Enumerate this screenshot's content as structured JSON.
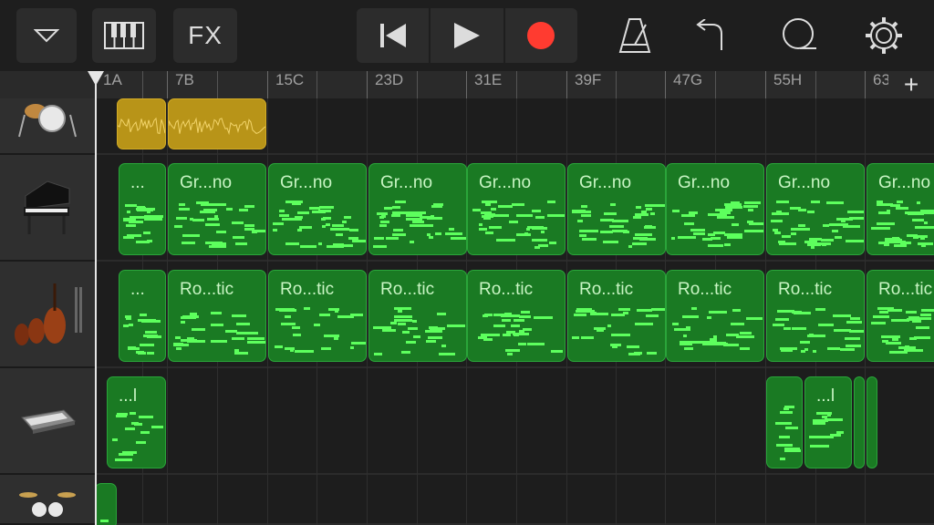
{
  "toolbar": {
    "dropdown_icon": "chevron-down-icon",
    "keyboard_icon": "piano-keyboard-icon",
    "fx_label": "FX",
    "rewind_icon": "skip-back-icon",
    "play_icon": "play-icon",
    "record_icon": "record-icon",
    "metronome_icon": "metronome-icon",
    "undo_icon": "undo-icon",
    "loop_icon": "loop-browser-icon",
    "settings_icon": "settings-gear-icon",
    "record_color": "#ff3b30"
  },
  "ruler": {
    "markers": [
      "1A",
      "7B",
      "15C",
      "23D",
      "31E",
      "39F",
      "47G",
      "55H",
      "63"
    ],
    "add_label": "+"
  },
  "tracks": [
    {
      "name": "drums",
      "icon": "drum-kit-icon"
    },
    {
      "name": "piano",
      "icon": "grand-piano-icon"
    },
    {
      "name": "strings",
      "icon": "string-ensemble-icon"
    },
    {
      "name": "keyboard",
      "icon": "synth-keyboard-icon"
    },
    {
      "name": "drums-2",
      "icon": "drum-kit-icon"
    }
  ],
  "regions": {
    "piano_first": "...",
    "piano": "Gr...no",
    "strings_first": "...",
    "strings": "Ro...tic",
    "keys": "...l"
  },
  "colors": {
    "region_green": "#1a7a23",
    "note_green": "#5dff5d",
    "audio_gold": "#b89418"
  }
}
